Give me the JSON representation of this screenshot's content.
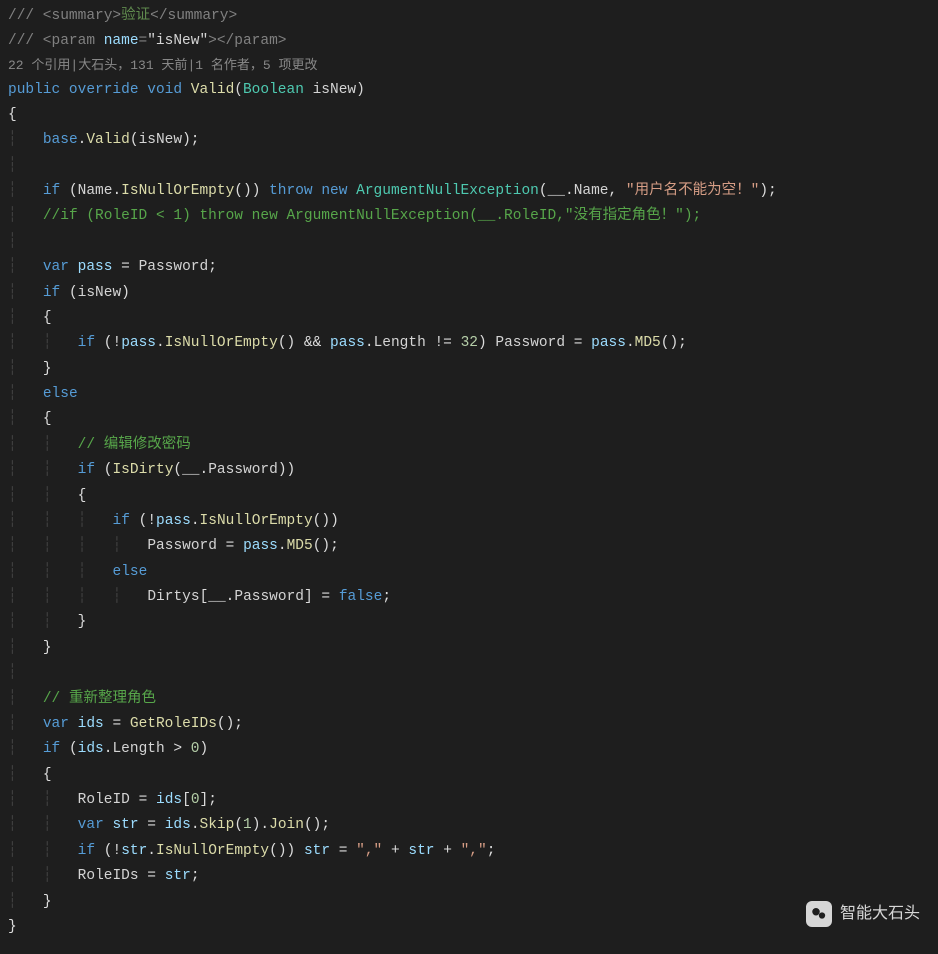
{
  "doc": {
    "summary_open": "/// <summary>",
    "summary_text": "验证",
    "summary_close": "</summary>",
    "param_prefix": "/// <param ",
    "param_name_attr": "name",
    "param_name_val": "\"isNew\"",
    "param_close": "></param>"
  },
  "codelens": {
    "refs": "22 个引用",
    "author": "大石头，131 天前",
    "authors": "1 名作者，5 项更改"
  },
  "sig": {
    "public": "public",
    "override": "override",
    "void": "void",
    "method": "Valid",
    "param_type": "Boolean",
    "param_name": "isNew"
  },
  "body": {
    "base": "base",
    "valid": "Valid",
    "isNew": "isNew",
    "if": "if",
    "else": "else",
    "throw": "throw",
    "new": "new",
    "var": "var",
    "Name": "Name",
    "IsNullOrEmpty": "IsNullOrEmpty",
    "ArgumentNullException": "ArgumentNullException",
    "under": "__",
    "err1": "\"用户名不能为空！\"",
    "commentRole": "//if (RoleID < 1) throw new ArgumentNullException(__.RoleID,\"没有指定角色！\");",
    "pass": "pass",
    "Password": "Password",
    "Length": "Length",
    "n32": "32",
    "MD5": "MD5",
    "commentEdit": "// 编辑修改密码",
    "IsDirty": "IsDirty",
    "Dirtys": "Dirtys",
    "false": "false",
    "commentRoles": "// 重新整理角色",
    "ids": "ids",
    "GetRoleIDs": "GetRoleIDs",
    "n0": "0",
    "RoleID": "RoleID",
    "str": "str",
    "Skip": "Skip",
    "n1": "1",
    "Join": "Join",
    "comma": "\",\"",
    "RoleIDs": "RoleIDs"
  },
  "watermark": {
    "text": "智能大石头"
  }
}
